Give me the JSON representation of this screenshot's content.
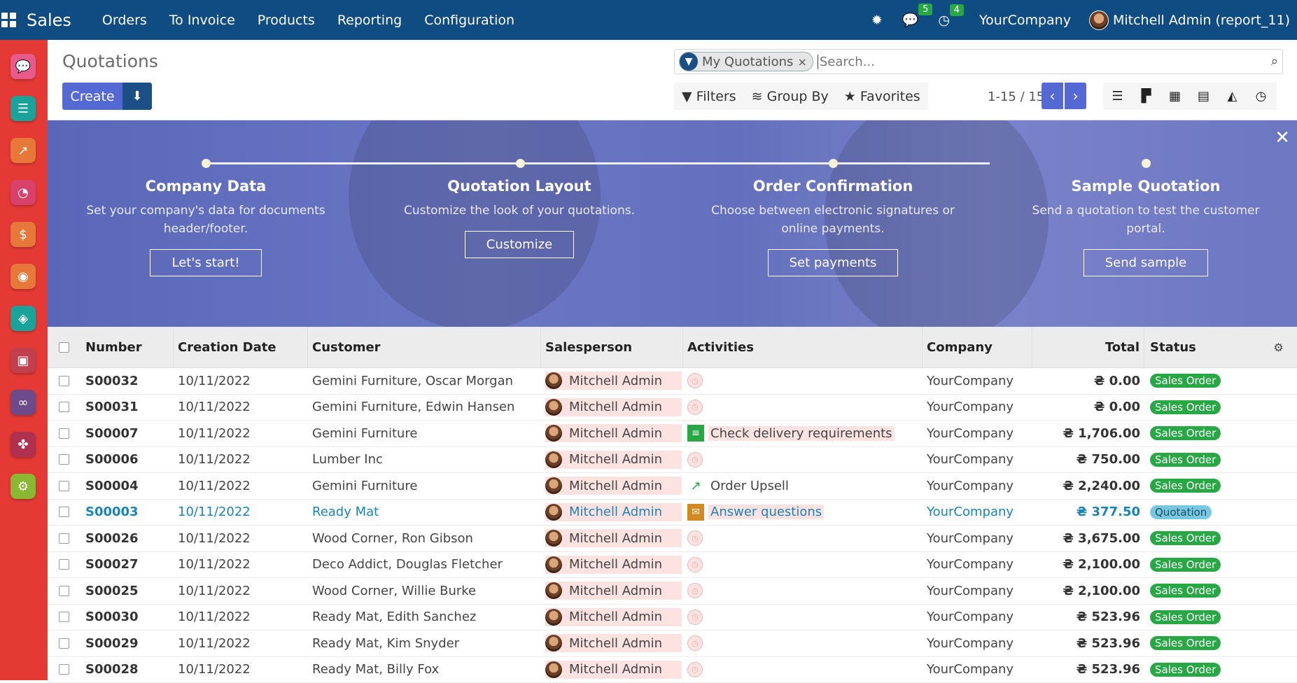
{
  "topbar": {
    "app": "Sales",
    "menu": [
      "Orders",
      "To Invoice",
      "Products",
      "Reporting",
      "Configuration"
    ],
    "chat_count": "5",
    "activity_count": "4",
    "company": "YourCompany",
    "user": "Mitchell Admin (report_11)"
  },
  "control": {
    "title": "Quotations",
    "create": "Create",
    "facet": "My Quotations",
    "search_placeholder": "Search...",
    "filters": "Filters",
    "group_by": "Group By",
    "favorites": "Favorites",
    "pager": "1-15 / 15"
  },
  "banner": {
    "steps": [
      {
        "title": "Company Data",
        "desc": "Set your company's data for documents header/footer.",
        "button": "Let's start!"
      },
      {
        "title": "Quotation Layout",
        "desc": "Customize the look of your quotations.",
        "button": "Customize"
      },
      {
        "title": "Order Confirmation",
        "desc": "Choose between electronic signatures or online payments.",
        "button": "Set payments"
      },
      {
        "title": "Sample Quotation",
        "desc": "Send a quotation to test the customer portal.",
        "button": "Send sample"
      }
    ]
  },
  "table": {
    "headers": {
      "number": "Number",
      "date": "Creation Date",
      "customer": "Customer",
      "salesperson": "Salesperson",
      "activities": "Activities",
      "company": "Company",
      "total": "Total",
      "status": "Status"
    },
    "rows": [
      {
        "number": "S00032",
        "date": "10/11/2022",
        "customer": "Gemini Furniture, Oscar Morgan",
        "salesperson": "Mitchell Admin",
        "activity": "",
        "activity_icon": "clock",
        "company": "YourCompany",
        "total": "₴ 0.00",
        "status": "Sales Order"
      },
      {
        "number": "S00031",
        "date": "10/11/2022",
        "customer": "Gemini Furniture, Edwin Hansen",
        "salesperson": "Mitchell Admin",
        "activity": "",
        "activity_icon": "clock",
        "company": "YourCompany",
        "total": "₴ 0.00",
        "status": "Sales Order"
      },
      {
        "number": "S00007",
        "date": "10/11/2022",
        "customer": "Gemini Furniture",
        "salesperson": "Mitchell Admin",
        "activity": "Check delivery requirements",
        "activity_icon": "tasks",
        "company": "YourCompany",
        "total": "₴ 1,706.00",
        "status": "Sales Order"
      },
      {
        "number": "S00006",
        "date": "10/11/2022",
        "customer": "Lumber Inc",
        "salesperson": "Mitchell Admin",
        "activity": "",
        "activity_icon": "clock",
        "company": "YourCompany",
        "total": "₴ 750.00",
        "status": "Sales Order"
      },
      {
        "number": "S00004",
        "date": "10/11/2022",
        "customer": "Gemini Furniture",
        "salesperson": "Mitchell Admin",
        "activity": "Order Upsell",
        "activity_icon": "chart",
        "company": "YourCompany",
        "total": "₴ 2,240.00",
        "status": "Sales Order"
      },
      {
        "number": "S00003",
        "date": "10/11/2022",
        "customer": "Ready Mat",
        "salesperson": "Mitchell Admin",
        "activity": "Answer questions",
        "activity_icon": "envelope",
        "company": "YourCompany",
        "total": "₴ 377.50",
        "status": "Quotation"
      },
      {
        "number": "S00026",
        "date": "10/11/2022",
        "customer": "Wood Corner, Ron Gibson",
        "salesperson": "Mitchell Admin",
        "activity": "",
        "activity_icon": "clock",
        "company": "YourCompany",
        "total": "₴ 3,675.00",
        "status": "Sales Order"
      },
      {
        "number": "S00027",
        "date": "10/11/2022",
        "customer": "Deco Addict, Douglas Fletcher",
        "salesperson": "Mitchell Admin",
        "activity": "",
        "activity_icon": "clock",
        "company": "YourCompany",
        "total": "₴ 2,100.00",
        "status": "Sales Order"
      },
      {
        "number": "S00025",
        "date": "10/11/2022",
        "customer": "Wood Corner, Willie Burke",
        "salesperson": "Mitchell Admin",
        "activity": "",
        "activity_icon": "clock",
        "company": "YourCompany",
        "total": "₴ 2,100.00",
        "status": "Sales Order"
      },
      {
        "number": "S00030",
        "date": "10/11/2022",
        "customer": "Ready Mat, Edith Sanchez",
        "salesperson": "Mitchell Admin",
        "activity": "",
        "activity_icon": "clock",
        "company": "YourCompany",
        "total": "₴ 523.96",
        "status": "Sales Order"
      },
      {
        "number": "S00029",
        "date": "10/11/2022",
        "customer": "Ready Mat, Kim Snyder",
        "salesperson": "Mitchell Admin",
        "activity": "",
        "activity_icon": "clock",
        "company": "YourCompany",
        "total": "₴ 523.96",
        "status": "Sales Order"
      },
      {
        "number": "S00028",
        "date": "10/11/2022",
        "customer": "Ready Mat, Billy Fox",
        "salesperson": "Mitchell Admin",
        "activity": "",
        "activity_icon": "clock",
        "company": "YourCompany",
        "total": "₴ 523.96",
        "status": "Sales Order"
      }
    ]
  }
}
